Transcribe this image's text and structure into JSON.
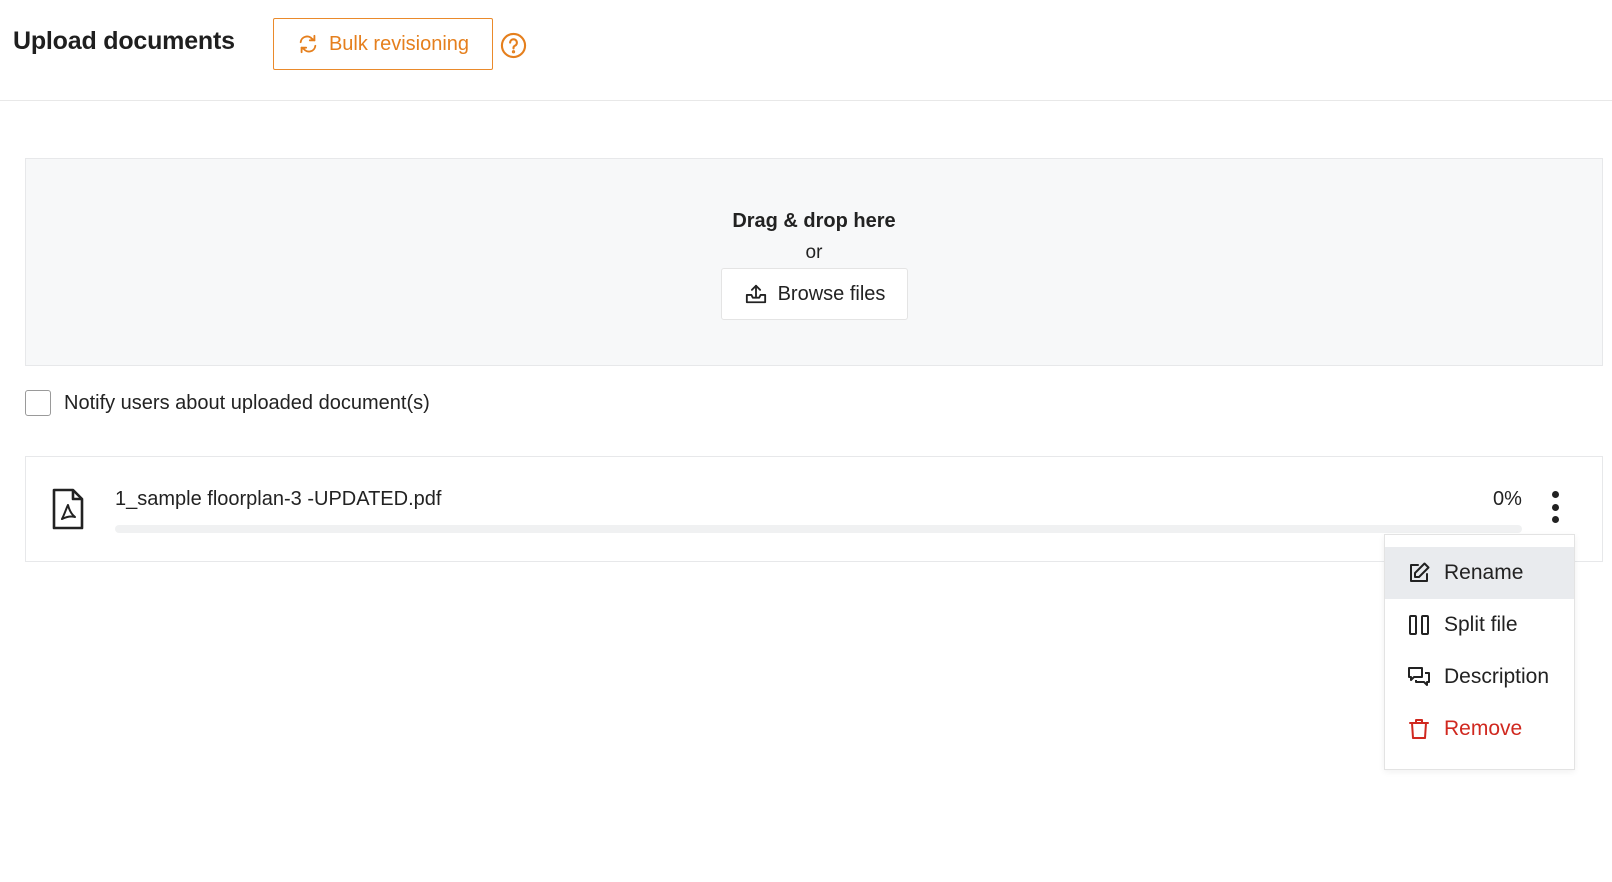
{
  "header": {
    "title": "Upload documents",
    "bulk_label": "Bulk revisioning",
    "help_icon": "help-circle-icon"
  },
  "dropzone": {
    "title": "Drag & drop here",
    "or": "or",
    "browse_label": "Browse files",
    "browse_icon": "upload-tray-icon"
  },
  "notify": {
    "label": "Notify users about uploaded document(s)",
    "checked": false
  },
  "file": {
    "name": "1_sample floorplan-3 -UPDATED.pdf",
    "percent": "0%",
    "progress": 0,
    "icon": "pdf-file-icon"
  },
  "menu": {
    "items": [
      {
        "label": "Rename",
        "icon": "edit-icon"
      },
      {
        "label": "Split file",
        "icon": "split-icon"
      },
      {
        "label": "Description",
        "icon": "chat-bubbles-icon"
      },
      {
        "label": "Remove",
        "icon": "trash-icon"
      }
    ]
  },
  "colors": {
    "accent": "#e57f1d",
    "danger": "#d0281f",
    "dropzone_bg": "#f7f8f9",
    "hover_bg": "#e9ebee"
  }
}
